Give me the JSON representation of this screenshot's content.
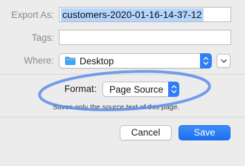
{
  "labels": {
    "export_as": "Export As:",
    "tags": "Tags:",
    "where": "Where:"
  },
  "export_as": {
    "value": "customers-2020-01-16-14-37-12"
  },
  "tags": {
    "value": ""
  },
  "where": {
    "selected": "Desktop",
    "icon": "folder-icon"
  },
  "format": {
    "label": "Format:",
    "selected": "Page Source",
    "description": "Saves only the source text of this page."
  },
  "buttons": {
    "cancel": "Cancel",
    "save": "Save"
  },
  "colors": {
    "accent": "#2f7df6",
    "selection": "#b4d5fe",
    "annotation": "#5b8ee8"
  }
}
